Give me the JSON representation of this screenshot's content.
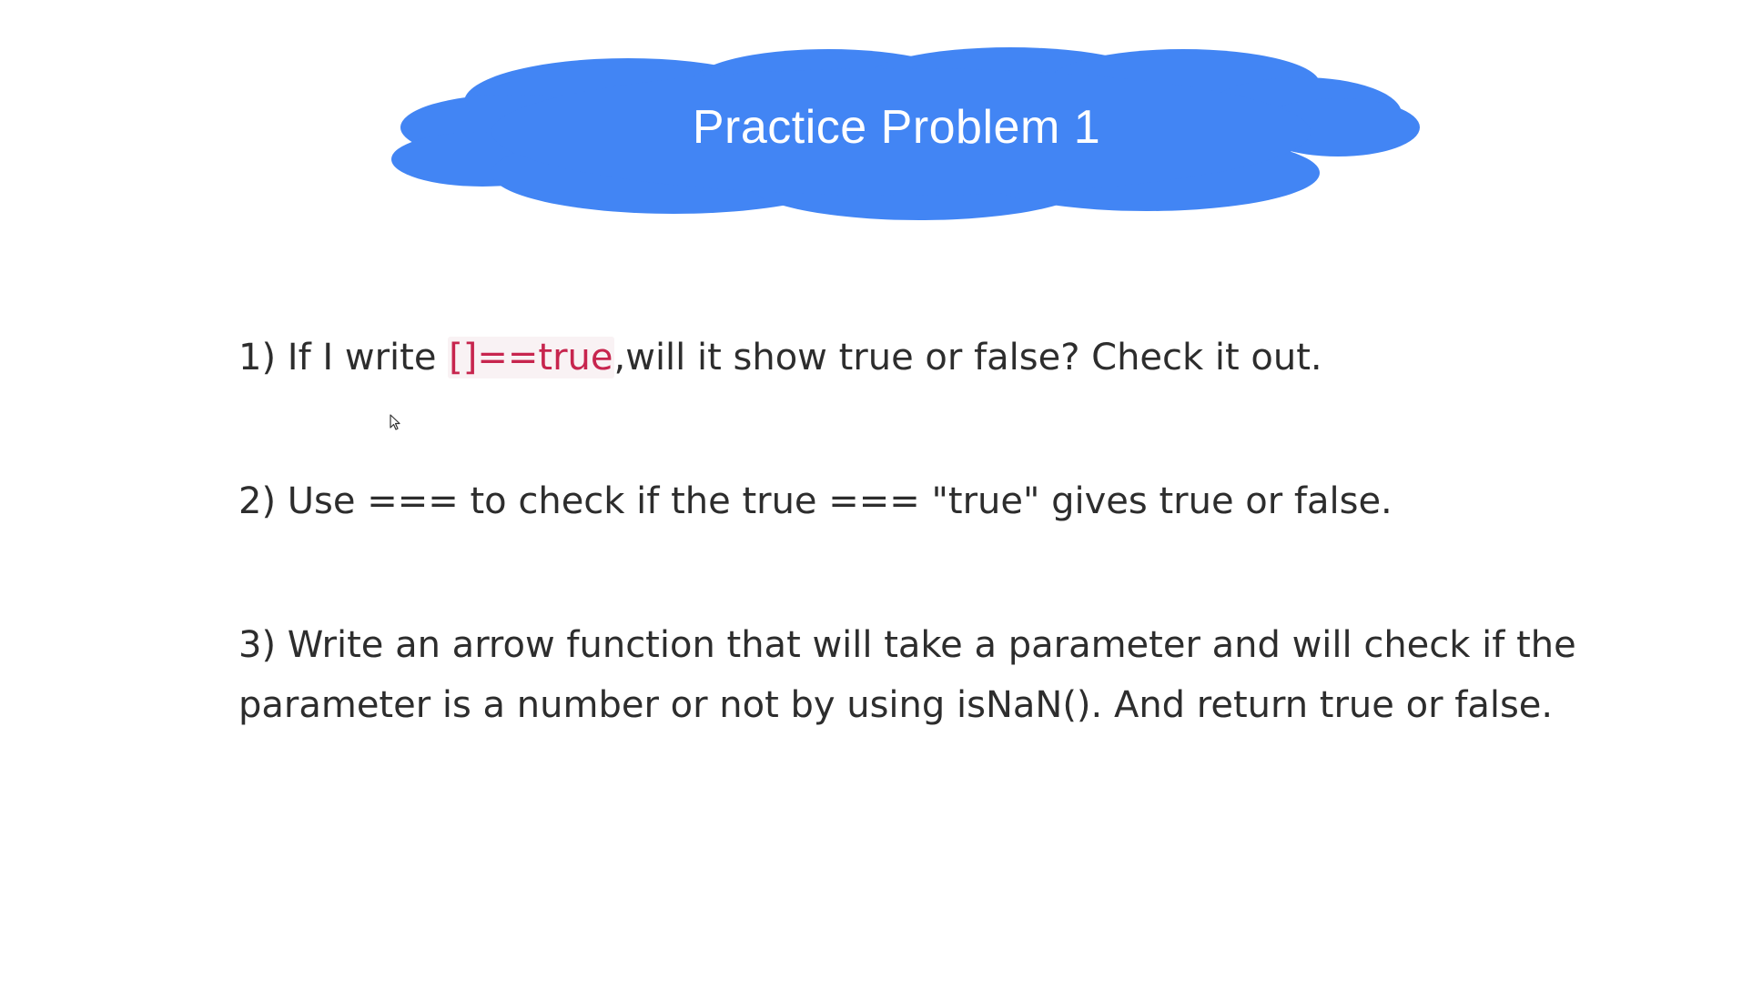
{
  "slide": {
    "title": "Practice Problem 1",
    "cloud_color": "#4285f4",
    "title_color": "#ffffff"
  },
  "problems": [
    {
      "number": "1)",
      "before": "If I write ",
      "code": "[]==true",
      "after": ",will it show true or false? Check it out."
    },
    {
      "number": "2)",
      "text": "Use === to check if the true === \"true\" gives true or false."
    },
    {
      "number": "3)",
      "text": "Write an arrow function that will take a parameter and will check if the parameter is a number or not by using isNaN(). And return true or false."
    }
  ],
  "colors": {
    "code_text": "#c7254e",
    "code_bg": "#f9f2f4",
    "body_text": "#2d2d2d"
  },
  "icons": {
    "cursor": "mouse-pointer-icon"
  }
}
